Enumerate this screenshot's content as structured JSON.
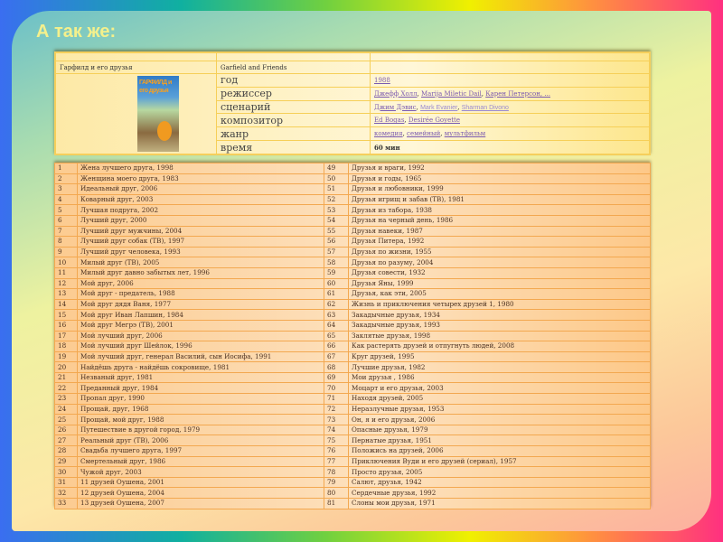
{
  "title": "А так же:",
  "info": {
    "name_ru": "Гарфилд и его друзья",
    "name_en": "Garfield and Friends",
    "cover_text": "ГАРФИЛД и его друзья",
    "fields": [
      {
        "label": "год",
        "values": [
          "1988"
        ]
      },
      {
        "label": "режиссер",
        "values": [
          "Джефф Холл",
          "Marija Miletic Dail",
          "Карен Петерсон, ..."
        ]
      },
      {
        "label": "сценарий",
        "values": [
          "Джим Дэвис",
          "Mark Evanier",
          "Sharman Divono"
        ]
      },
      {
        "label": "композитор",
        "values": [
          "Ed Bogas",
          "Desirée Goyette"
        ]
      },
      {
        "label": "жанр",
        "values": [
          "комедия",
          "семейный",
          "мультфильм"
        ]
      },
      {
        "label": "время",
        "text": "60 мин"
      }
    ]
  },
  "films": [
    [
      "1",
      "Жена лучшего друга, 1998",
      "49",
      "Друзья и враги, 1992"
    ],
    [
      "2",
      "Женщина моего друга, 1983",
      "50",
      "Друзья и годы, 1965"
    ],
    [
      "3",
      "Идеальный друг, 2006",
      "51",
      "Друзья и любовники, 1999"
    ],
    [
      "4",
      "Коварный друг, 2003",
      "52",
      "Друзья игрищ и забав (ТВ), 1981"
    ],
    [
      "5",
      "Лучшая подруга, 2002",
      "53",
      "Друзья из табора, 1938"
    ],
    [
      "6",
      "Лучший друг, 2000",
      "54",
      "Друзья на черный день, 1986"
    ],
    [
      "7",
      "Лучший друг мужчины, 2004",
      "55",
      "Друзья навеки, 1987"
    ],
    [
      "8",
      "Лучший друг собак (ТВ), 1997",
      "56",
      "Друзья Питера, 1992"
    ],
    [
      "9",
      "Лучший друг человека, 1993",
      "57",
      "Друзья по жизни, 1955"
    ],
    [
      "10",
      "Милый друг (ТВ), 2005",
      "58",
      "Друзья по разуму, 2004"
    ],
    [
      "11",
      "Милый друг давно забытых лет, 1996",
      "59",
      "Друзья совести, 1932"
    ],
    [
      "12",
      "Мой друг, 2006",
      "60",
      "Друзья Яны, 1999"
    ],
    [
      "13",
      "Мой друг - предатель, 1988",
      "61",
      "Друзья, как эти, 2005"
    ],
    [
      "14",
      "Мой друг дядя Ваня, 1977",
      "62",
      "Жизнь и приключения четырех друзей 1, 1980"
    ],
    [
      "15",
      "Мой друг Иван Лапшин, 1984",
      "63",
      "Закадычные друзья, 1934"
    ],
    [
      "16",
      "Мой друг Мегрэ (ТВ), 2001",
      "64",
      "Закадычные друзья, 1993"
    ],
    [
      "17",
      "Мой лучший друг, 2006",
      "65",
      "Заклятые друзья, 1998"
    ],
    [
      "18",
      "Мой лучший друг Шейлок, 1996",
      "66",
      "Как растерять друзей и отпугнуть людей, 2008"
    ],
    [
      "19",
      "Мой лучший друг, генерал Василий, сын Иосифа, 1991",
      "67",
      "Круг друзей, 1995"
    ],
    [
      "20",
      "Найдёшь друга - найдёшь сокровище, 1981",
      "68",
      "Лучшие друзья, 1982"
    ],
    [
      "21",
      "Незваный друг, 1981",
      "69",
      "Мои друзья , 1986"
    ],
    [
      "22",
      "Преданный друг, 1984",
      "70",
      "Моцарт и его друзья, 2003"
    ],
    [
      "23",
      "Пропал друг, 1990",
      "71",
      "Находя друзей, 2005"
    ],
    [
      "24",
      "Прощай, друг, 1968",
      "72",
      "Неразлучные друзья, 1953"
    ],
    [
      "25",
      "Прощай, мой друг, 1988",
      "73",
      "Он, я и его друзья, 2006"
    ],
    [
      "26",
      "Путешествие в другой город, 1979",
      "74",
      "Опасные друзья, 1979"
    ],
    [
      "27",
      "Реальный друг (ТВ), 2006",
      "75",
      "Пернатые друзья, 1951"
    ],
    [
      "28",
      "Свадьба лучшего друга, 1997",
      "76",
      "Положись на друзей, 2006"
    ],
    [
      "29",
      "Смертельный друг, 1986",
      "77",
      "Приключения Вуди и его друзей (сериал), 1957"
    ],
    [
      "30",
      "Чужой друг, 2003",
      "78",
      "Просто друзья, 2005"
    ],
    [
      "31",
      "11 друзей Оушена, 2001",
      "79",
      "Салют, друзья, 1942"
    ],
    [
      "32",
      "12 друзей Оушена, 2004",
      "80",
      "Сердечные друзья, 1992"
    ],
    [
      "33",
      "13 друзей Оушена, 2007",
      "81",
      "Слоны мои друзья, 1971"
    ]
  ]
}
